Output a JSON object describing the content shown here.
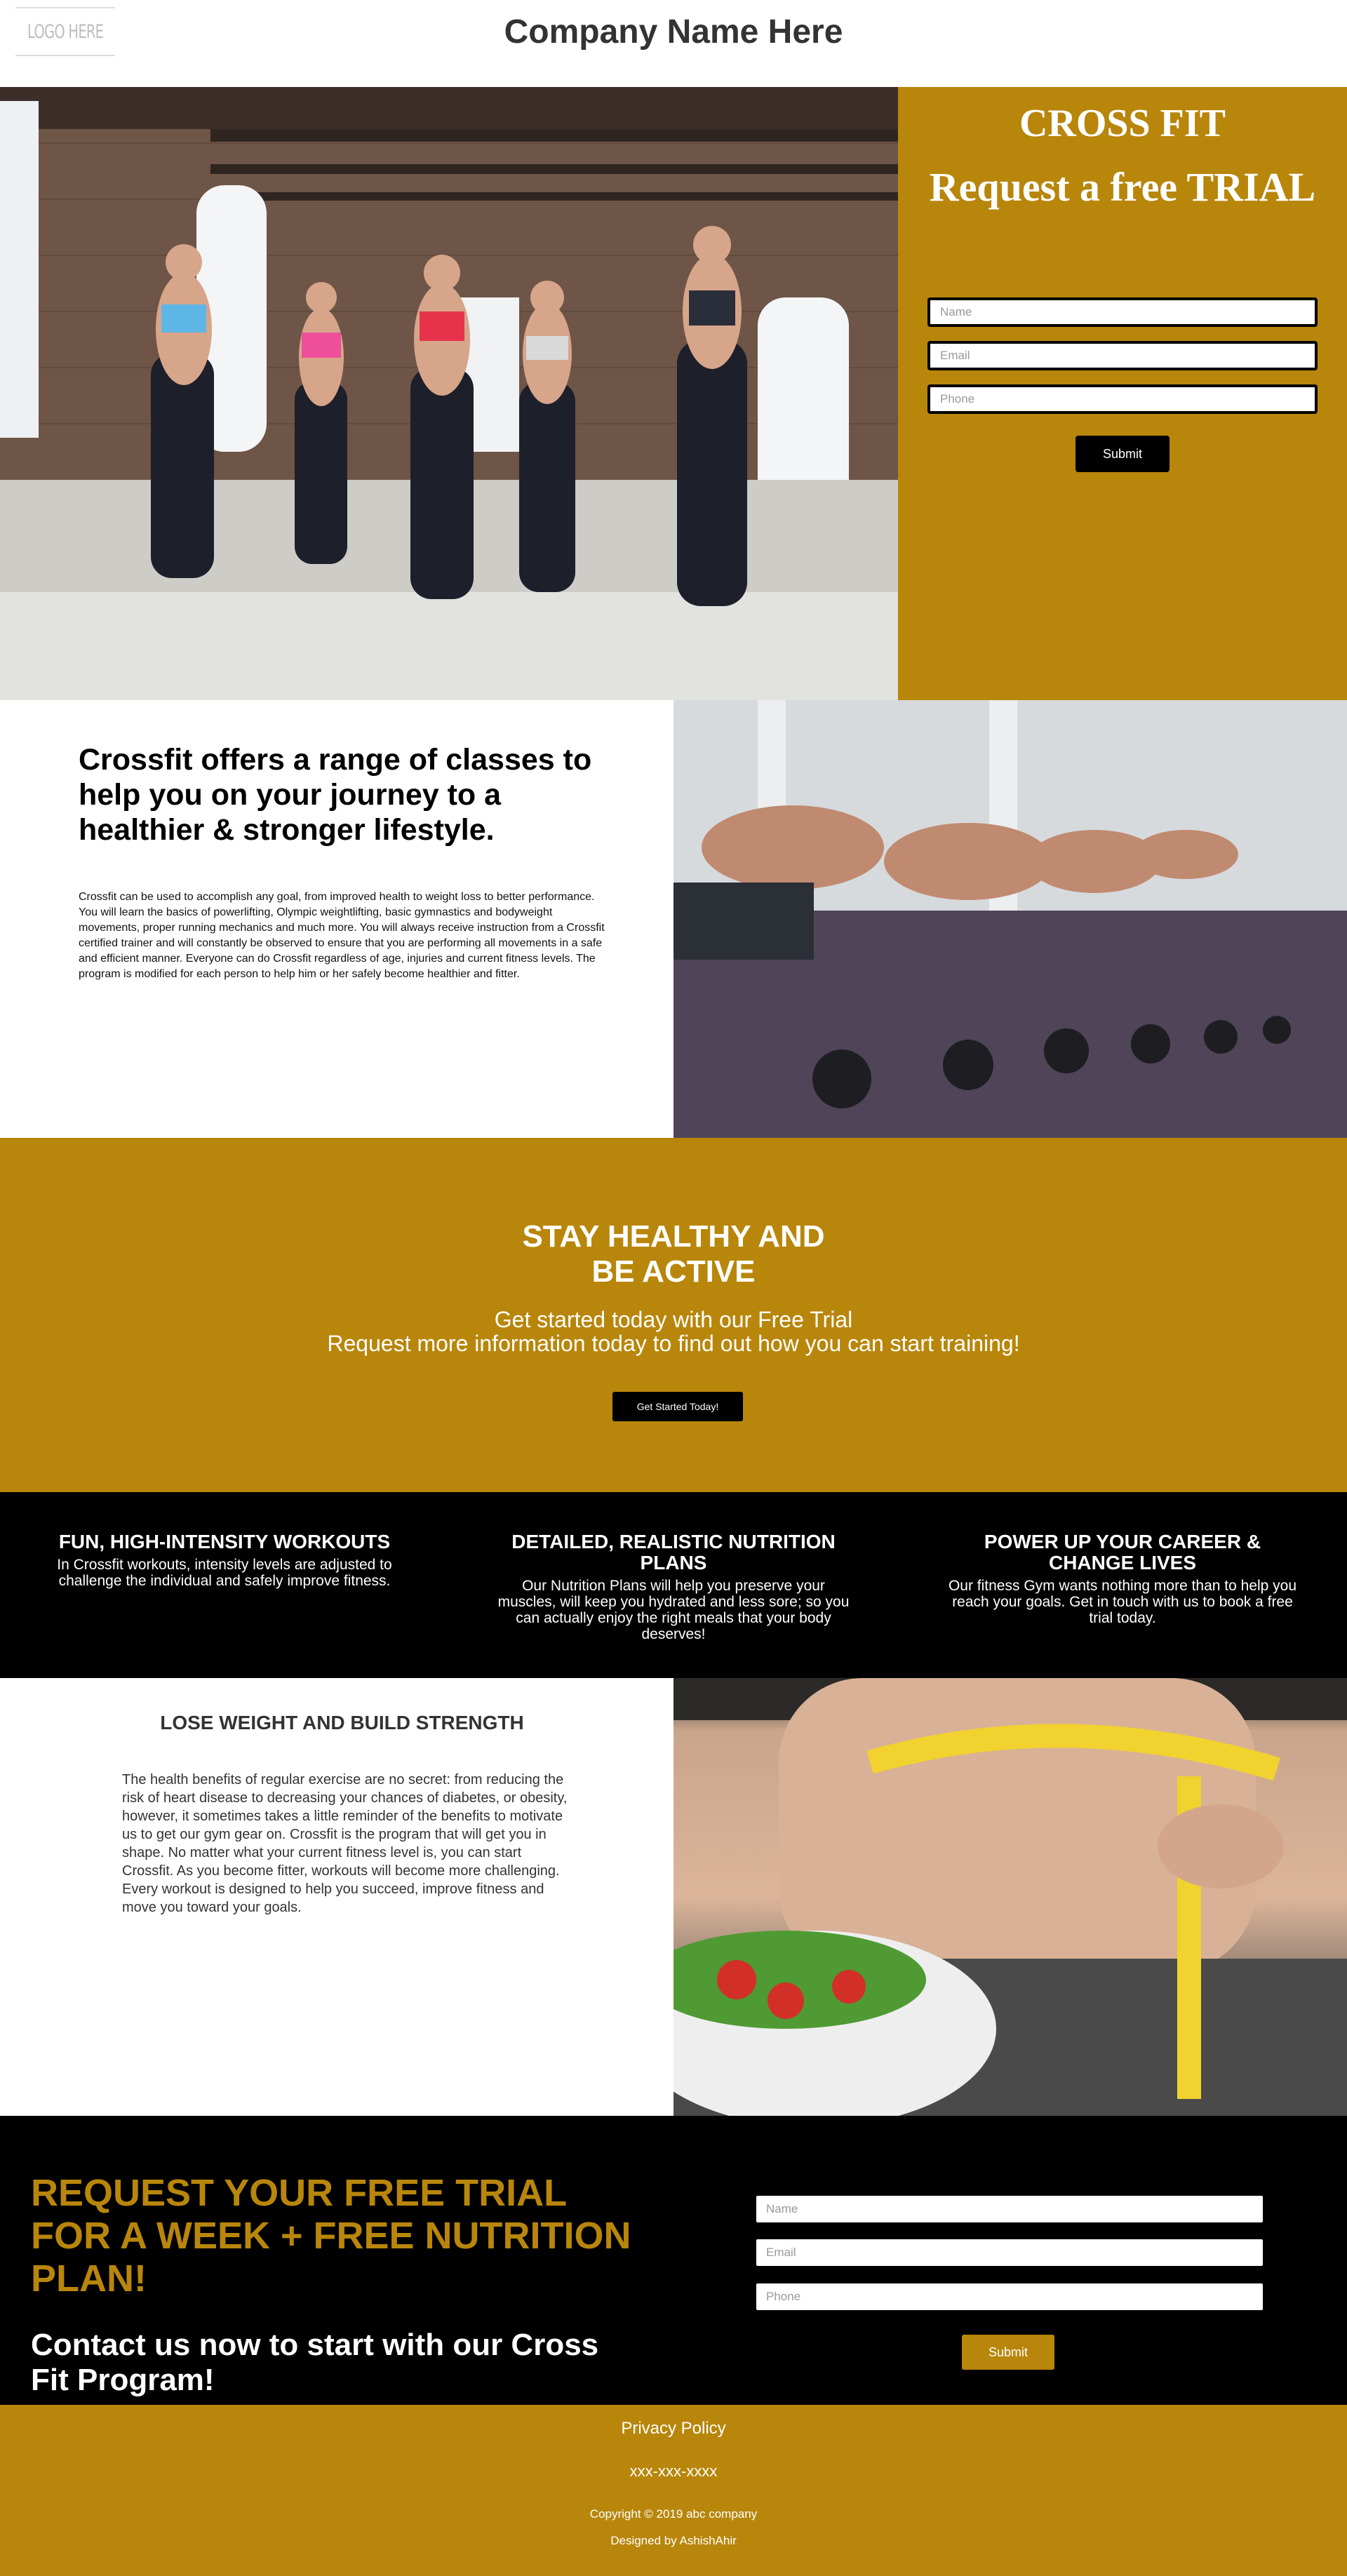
{
  "header": {
    "logo_text": "LOGO HERE",
    "company_name": "Company Name Here"
  },
  "hero": {
    "title": "CROSS FIT",
    "subtitle": "Request a free TRIAL",
    "form": {
      "name_placeholder": "Name",
      "email_placeholder": "Email",
      "phone_placeholder": "Phone",
      "submit_label": "Submit"
    }
  },
  "intro": {
    "heading": "Crossfit offers a range of classes to help you on your journey to a healthier & stronger lifestyle.",
    "body": "Crossfit can be used to accomplish any goal, from improved health to weight loss to better performance. You will learn the basics of powerlifting, Olympic weightlifting, basic gymnastics and bodyweight movements, proper running mechanics and much more. You will always receive instruction from a Crossfit certified trainer and will constantly be observed to ensure that you are performing all movements in a safe and efficient manner. Everyone can do Crossfit regardless of age, injuries and current fitness levels. The program is modified for each person to help him or her safely become healthier and fitter."
  },
  "stay": {
    "title_line1": "STAY HEALTHY AND",
    "title_line2": "BE ACTIVE",
    "sub_line1": "Get started today with our Free Trial",
    "sub_line2": "Request more information today to find out how you can start training!",
    "button_label": "Get Started Today!"
  },
  "features": [
    {
      "title": "FUN, HIGH-INTENSITY WORKOUTS",
      "body": "In Crossfit workouts, intensity levels are adjusted to challenge the individual and safely improve fitness."
    },
    {
      "title": "DETAILED, REALISTIC NUTRITION PLANS",
      "body": "Our Nutrition Plans will help you preserve your muscles, will keep you hydrated and less sore; so you can actually enjoy the right meals that your body deserves!"
    },
    {
      "title": "POWER UP YOUR CAREER & CHANGE LIVES",
      "body": "Our fitness Gym wants nothing more than to help you reach your goals. Get in touch with us to book a free trial today."
    }
  ],
  "lose": {
    "heading": "LOSE WEIGHT AND BUILD STRENGTH",
    "body": "The health benefits of regular exercise are no secret: from reducing the risk of heart disease to decreasing your chances of diabetes, or obesity, however, it sometimes takes a little reminder of the benefits to motivate us to get our gym gear on. Crossfit is the program that will get you in shape. No matter what your current fitness level is, you can start Crossfit. As you become fitter, workouts will become more challenging. Every workout is designed to help you succeed, improve fitness and move you toward your goals."
  },
  "trial": {
    "headline": "REQUEST YOUR FREE TRIAL FOR A WEEK + FREE NUTRITION PLAN!",
    "cta": "Contact us now to start with our Cross Fit Program!",
    "form": {
      "name_placeholder": "Name",
      "email_placeholder": "Email",
      "phone_placeholder": "Phone",
      "submit_label": "Submit"
    }
  },
  "footer": {
    "privacy": "Privacy Policy",
    "phone": "xxx-xxx-xxxx",
    "copyright": "Copyright © 2019 abc company",
    "designed_by": "Designed by AshishAhir"
  },
  "colors": {
    "accent": "#b8860b",
    "dark": "#000000",
    "light": "#ffffff"
  }
}
